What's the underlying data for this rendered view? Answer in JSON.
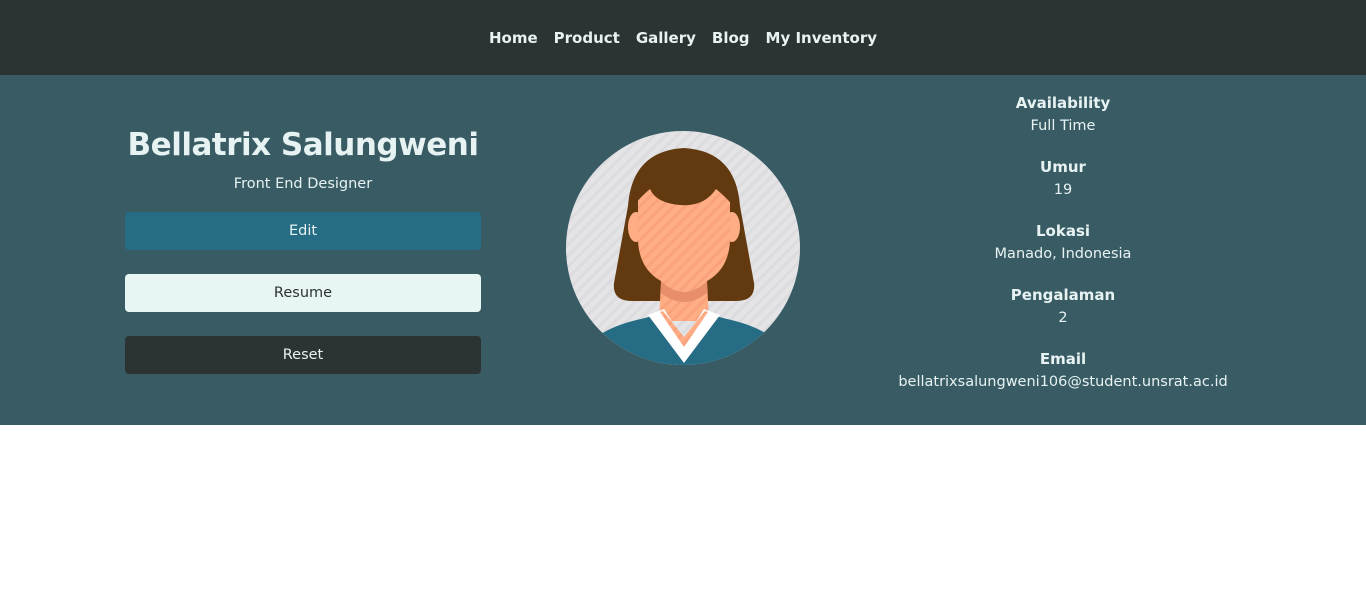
{
  "nav": {
    "items": [
      {
        "label": "Home"
      },
      {
        "label": "Product"
      },
      {
        "label": "Gallery"
      },
      {
        "label": "Blog"
      },
      {
        "label": "My Inventory"
      }
    ]
  },
  "profile": {
    "name": "Bellatrix Salungweni",
    "role": "Front End Designer",
    "buttons": {
      "edit": "Edit",
      "resume": "Resume",
      "reset": "Reset"
    },
    "avatar_icon": "female-avatar-icon"
  },
  "details": [
    {
      "label": "Availability",
      "value": "Full Time"
    },
    {
      "label": "Umur",
      "value": "19"
    },
    {
      "label": "Lokasi",
      "value": "Manado, Indonesia"
    },
    {
      "label": "Pengalaman",
      "value": "2"
    },
    {
      "label": "Email",
      "value": "bellatrixsalungweni106@student.unsrat.ac.id"
    }
  ],
  "colors": {
    "nav_bg": "#2c3333",
    "hero_bg": "#395b64",
    "edit_button": "#266c85",
    "resume_button": "#e7f6f2",
    "reset_button": "#2c3333",
    "text_light": "#e7f3f2"
  }
}
